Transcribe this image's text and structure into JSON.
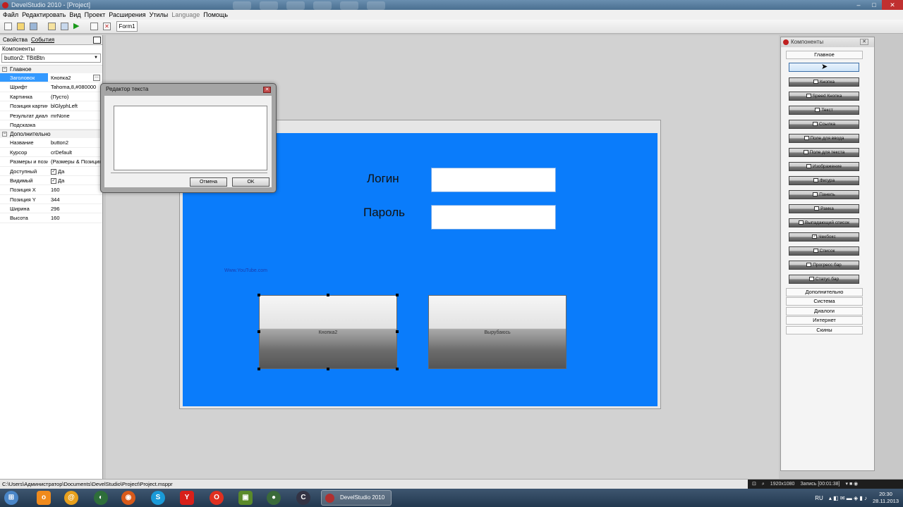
{
  "window": {
    "title": "DevelStudio 2010 - [Project]"
  },
  "menu": [
    "Файл",
    "Редактировать",
    "Вид",
    "Проект",
    "Расширения",
    "Утилы",
    "Language",
    "Помощь"
  ],
  "toolbar": {
    "form_tab": "Form1"
  },
  "inspector": {
    "tab_props": "Свойства",
    "tab_events": "События",
    "components_label": "Компоненты",
    "selected_component": "button2: TBitBtn",
    "section_main": "Главное",
    "main_props": [
      {
        "key": "Заголовок",
        "value": "Кнопка2"
      },
      {
        "key": "Шрифт",
        "value": "Tahoma,8,#080000"
      },
      {
        "key": "Картинка",
        "value": "(Пусто)"
      },
      {
        "key": "Позиция картинки",
        "value": "blGlyphLeft"
      },
      {
        "key": "Результат диалога",
        "value": "mrNone"
      },
      {
        "key": "Подсказка",
        "value": ""
      }
    ],
    "section_extra": "Дополнительно",
    "extra_props": [
      {
        "key": "Название",
        "value": "button2"
      },
      {
        "key": "Курсор",
        "value": "crDefault"
      },
      {
        "key": "Размеры и позиция",
        "value": "(Размеры & Позиция)"
      },
      {
        "key": "Доступный",
        "value": "Да"
      },
      {
        "key": "Видимый",
        "value": "Да"
      },
      {
        "key": "Позиция X",
        "value": "160"
      },
      {
        "key": "Позиция Y",
        "value": "344"
      },
      {
        "key": "Ширина",
        "value": "296"
      },
      {
        "key": "Высота",
        "value": "160"
      }
    ]
  },
  "form": {
    "login_label": "Логин",
    "password_label": "Пароль",
    "link_text": "Www.YouTube.com",
    "button1_caption": "Кнопка2",
    "button2_caption": "Вырубаюсь"
  },
  "dialog": {
    "title": "Редактор текста",
    "text": "",
    "cancel": "Отмена",
    "ok": "OK"
  },
  "palette": {
    "title": "Компоненты",
    "group_main": "Главное",
    "buttons": [
      "",
      "Кнопка",
      "Speed Кнопка",
      "Текст",
      "Ссылка",
      "Поле для ввода",
      "Поле для текста",
      "Изображение",
      "Фигура",
      "Панель",
      "Рамка",
      "Выпадающий список",
      "Чекбокс",
      "Список",
      "Прогресс бар",
      "Статус бар"
    ],
    "groups": [
      "Дополнительно",
      "Система",
      "Диалоги",
      "Интернет",
      "Скины"
    ]
  },
  "statusbar": {
    "path": "C:\\Users\\Администратор\\Documents\\DevelStudio\\Project\\Project.msppr",
    "resolution": "1920x1080",
    "record": "Запись [00:01:38]"
  },
  "taskbar": {
    "active_item": "DevelStudio 2010 ...",
    "lang": "RU",
    "time": "20:30",
    "date": "28.11.2013"
  }
}
